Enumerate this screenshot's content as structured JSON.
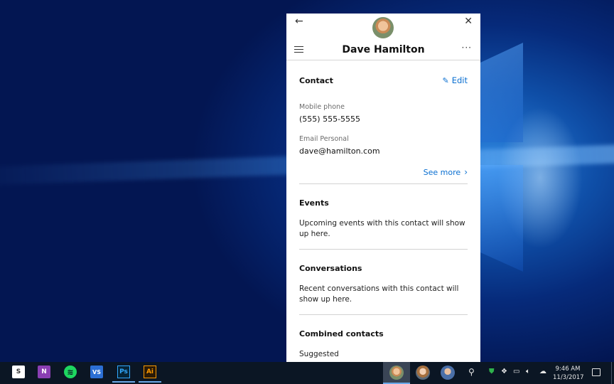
{
  "panel": {
    "title": "Dave Hamilton",
    "back_icon": "back-arrow-icon",
    "close_icon": "close-icon",
    "more_icon": "more-icon",
    "menu_icon": "hamburger-menu-icon"
  },
  "contact": {
    "title": "Contact",
    "edit_label": "Edit",
    "fields": [
      {
        "label": "Mobile phone",
        "value": "(555) 555-5555"
      },
      {
        "label": "Email Personal",
        "value": "dave@hamilton.com"
      }
    ],
    "see_more_label": "See more"
  },
  "events": {
    "title": "Events",
    "body": "Upcoming events with this contact will show up here."
  },
  "conversations": {
    "title": "Conversations",
    "body": "Recent conversations with this contact will show up here."
  },
  "combined": {
    "title": "Combined contacts",
    "sub_label": "Suggested"
  },
  "taskbar": {
    "apps": [
      {
        "name": "store-icon",
        "glyph": "S"
      },
      {
        "name": "onenote-icon",
        "glyph": "N"
      },
      {
        "name": "spotify-icon",
        "glyph": "≋"
      },
      {
        "name": "vs-icon",
        "glyph": "VS"
      },
      {
        "name": "ps-icon",
        "glyph": "Ps"
      },
      {
        "name": "ai-icon",
        "glyph": "Ai"
      }
    ],
    "time": "9:46 AM",
    "date": "11/3/2017"
  },
  "colors": {
    "accent": "#0a6fd1",
    "taskbar_bg": "#0b1624"
  }
}
